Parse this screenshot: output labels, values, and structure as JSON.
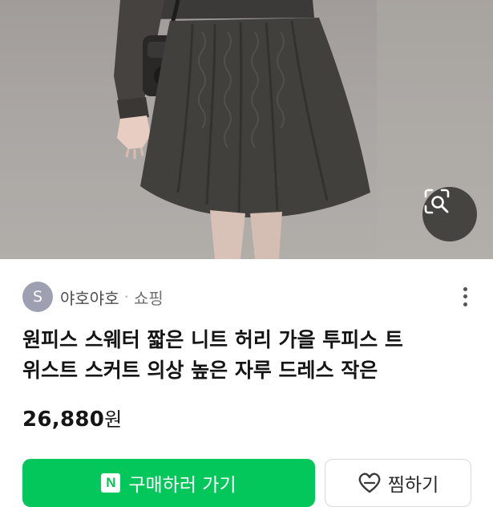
{
  "product": {
    "image_alt": "product photo: dark grey cable-knit flared mini skirt",
    "seller_initial": "S",
    "seller": "야호야호",
    "separator": "·",
    "category": "쇼핑",
    "title_line1": "원피스 스웨터 짧은 니트 허리 가을 투피스 트",
    "title_line2": "위스트 스커트 의상 높은 자루 드레스 작은",
    "price_number": "26,880",
    "price_unit": "원"
  },
  "actions": {
    "buy_icon": "N",
    "buy_label": "구매하러 가기",
    "wish_label": "찜하기"
  },
  "colors": {
    "accent": "#03c75a",
    "avatar": "#9da0b0"
  },
  "icons": {
    "lens": "image-search-icon",
    "more": "more-vertical-icon",
    "brand": "naver-n-icon",
    "wish": "heart-icon"
  }
}
